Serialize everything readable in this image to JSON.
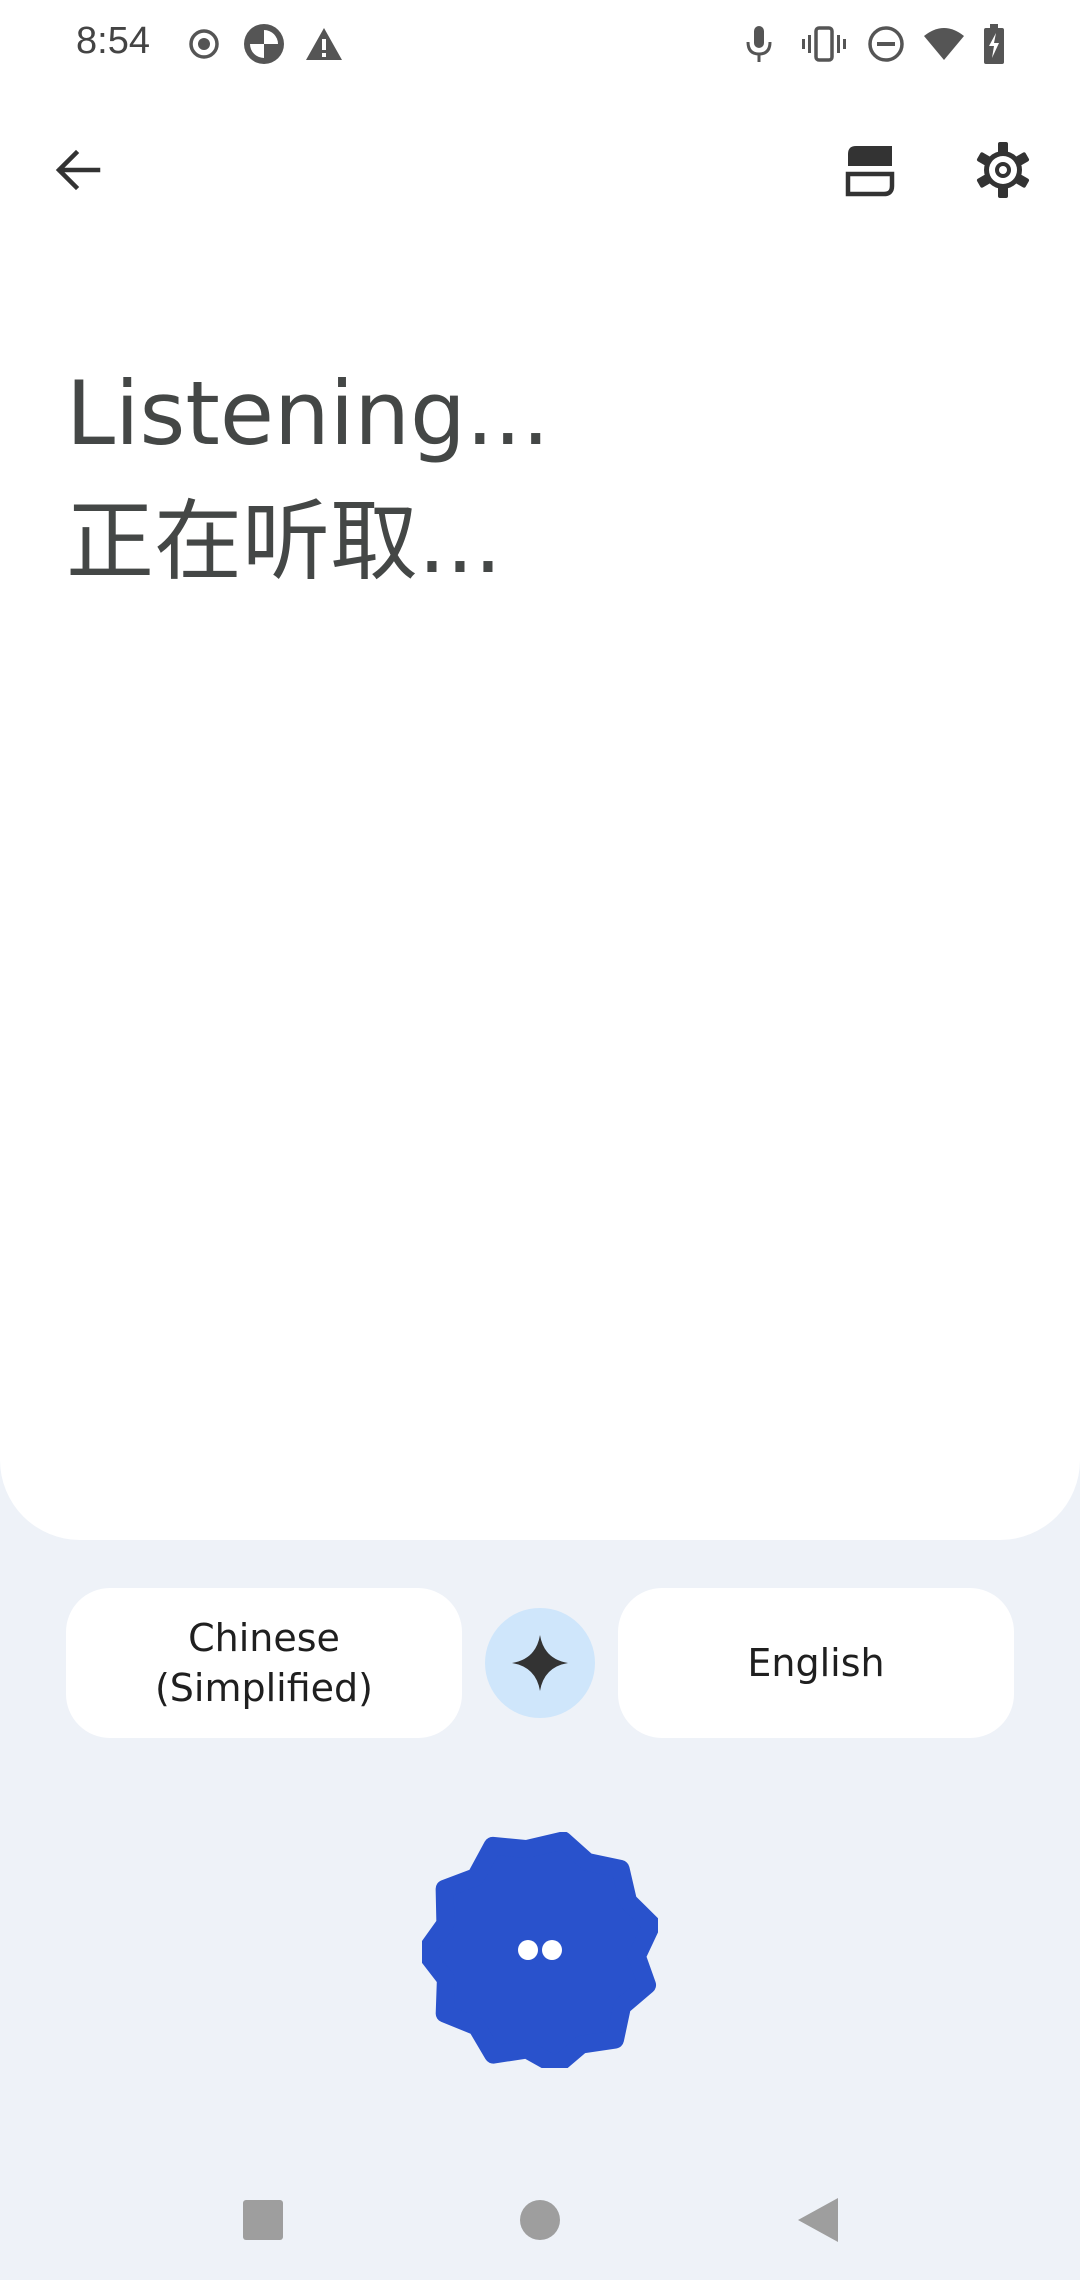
{
  "status_bar": {
    "time": "8:54",
    "left_icons": [
      "record-icon",
      "app-notification-icon",
      "warning-icon"
    ],
    "right_icons": [
      "microphone-icon",
      "vibrate-icon",
      "do-not-disturb-icon",
      "wifi-icon",
      "battery-charging-icon"
    ]
  },
  "app_bar": {
    "back_icon": "arrow-left-icon",
    "actions": [
      "split-view-icon",
      "gear-icon"
    ]
  },
  "transcript": {
    "source_status": "Listening...",
    "target_status": "正在听取..."
  },
  "languages": {
    "source": "Chinese\n(Simplified)",
    "target": "English",
    "swap_icon": "sparkle-icon"
  },
  "mic": {
    "icon": "listening-dots-icon"
  },
  "nav": {
    "icons": [
      "recents-square-icon",
      "home-circle-icon",
      "back-triangle-icon"
    ]
  },
  "colors": {
    "background": "#eef2f8",
    "card": "#ffffff",
    "text_primary": "#444746",
    "swap_bg": "#cfe6fb",
    "mic_blue": "#2952cc"
  }
}
